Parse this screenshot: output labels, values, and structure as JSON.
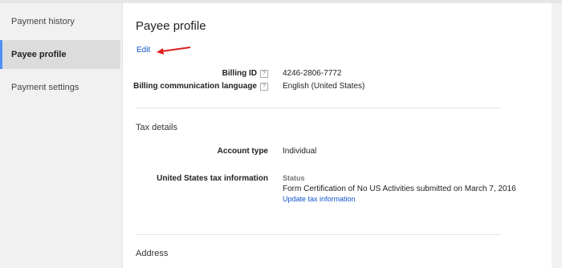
{
  "sidebar": {
    "items": [
      {
        "label": "Payment history"
      },
      {
        "label": "Payee profile"
      },
      {
        "label": "Payment settings"
      }
    ]
  },
  "main": {
    "title": "Payee profile",
    "edit_label": "Edit",
    "billing": {
      "billing_id_label": "Billing ID",
      "billing_id_value": "4246-2806-7772",
      "language_label": "Billing communication language",
      "language_value": "English (United States)"
    },
    "tax": {
      "section_title": "Tax details",
      "account_type_label": "Account type",
      "account_type_value": "Individual",
      "us_tax_label": "United States tax information",
      "status_label": "Status",
      "status_text": "Form Certification of No US Activities submitted on March 7, 2016",
      "update_link": "Update tax information"
    },
    "address": {
      "section_title": "Address"
    }
  },
  "colors": {
    "link": "#1155cc",
    "active_indicator": "#4d90fe",
    "annotation_arrow": "#e02020"
  },
  "icons": [
    "help-icon",
    "annotation-arrow"
  ]
}
